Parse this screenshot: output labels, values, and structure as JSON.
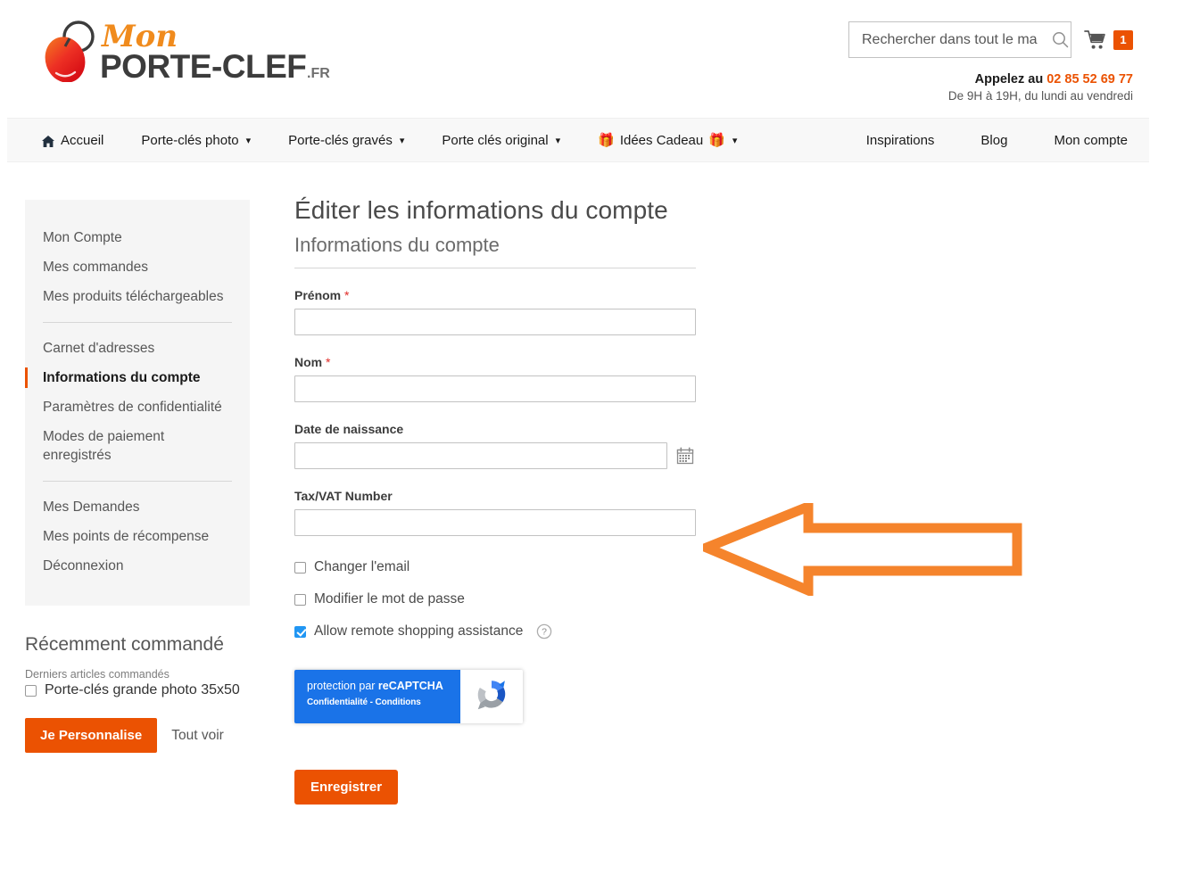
{
  "brand": {
    "logo_top": "Mon",
    "logo_main": "PORTE-CLEF",
    "logo_tld": ".FR",
    "accent_color": "#eb5202",
    "logo_dark": "#3c3c3c"
  },
  "header": {
    "search": {
      "placeholder": "Rechercher dans tout le ma",
      "value": "",
      "icon": "search-icon"
    },
    "cart": {
      "icon": "cart-icon",
      "count": "1",
      "badge_color": "#eb5202"
    },
    "phone_label": "Appelez au",
    "phone_number": "02 85 52 69 77",
    "hours": "De 9H à 19H, du lundi au vendredi"
  },
  "nav": {
    "left": [
      {
        "label": "Accueil",
        "icon": "home-icon",
        "caret": false
      },
      {
        "label": "Porte-clés photo",
        "caret": true
      },
      {
        "label": "Porte-clés gravés",
        "caret": true
      },
      {
        "label": "Porte clés original",
        "caret": true
      },
      {
        "label": "Idées Cadeau",
        "gift_left": "🎁",
        "gift_right": "🎁",
        "caret": true
      }
    ],
    "right": [
      {
        "label": "Inspirations"
      },
      {
        "label": "Blog"
      },
      {
        "label": "Mon compte"
      }
    ]
  },
  "sidebar": {
    "group1": [
      {
        "label": "Mon Compte",
        "current": false
      },
      {
        "label": "Mes commandes",
        "current": false
      },
      {
        "label": "Mes produits téléchargeables",
        "current": false
      }
    ],
    "group2": [
      {
        "label": "Carnet d'adresses",
        "current": false
      },
      {
        "label": "Informations du compte",
        "current": true
      },
      {
        "label": "Paramètres de confidentialité",
        "current": false
      },
      {
        "label": "Modes de paiement enregistrés",
        "current": false
      }
    ],
    "group3": [
      {
        "label": "Mes Demandes",
        "current": false
      },
      {
        "label": "Mes points de récompense",
        "current": false
      },
      {
        "label": "Déconnexion",
        "current": false
      }
    ]
  },
  "recent": {
    "title": "Récemment commandé",
    "subtitle": "Derniers articles commandés",
    "items": [
      {
        "label": "Porte-clés grande photo 35x50",
        "checked": false
      }
    ],
    "primary_button": "Je Personnalise",
    "secondary_link": "Tout voir"
  },
  "main": {
    "page_title": "Éditer les informations du compte",
    "legend": "Informations du compte",
    "fields": [
      {
        "label": "Prénom",
        "required": true,
        "value": "",
        "placeholder": "",
        "has_calendar": false
      },
      {
        "label": "Nom",
        "required": true,
        "value": "",
        "placeholder": "",
        "has_calendar": false
      },
      {
        "label": "Date de naissance",
        "required": false,
        "value": "",
        "placeholder": "",
        "has_calendar": true
      },
      {
        "label": "Tax/VAT Number",
        "required": false,
        "value": "",
        "placeholder": "",
        "has_calendar": false
      }
    ],
    "required_marker": "*",
    "checkboxes": [
      {
        "label": "Changer l'email",
        "checked": false,
        "help": false
      },
      {
        "label": "Modifier le mot de passe",
        "checked": false,
        "help": false
      },
      {
        "label": "Allow remote shopping assistance",
        "checked": true,
        "help": true
      }
    ],
    "recaptcha": {
      "line1_prefix": "protection par ",
      "line1_strong": "reCAPTCHA",
      "line2": "Confidentialité - Conditions",
      "bg_color": "#1a73e8"
    },
    "save_button": "Enregistrer"
  },
  "annotation": {
    "type": "arrow",
    "direction": "left",
    "color": "#f5842c",
    "points_at": "Tax/VAT Number"
  }
}
